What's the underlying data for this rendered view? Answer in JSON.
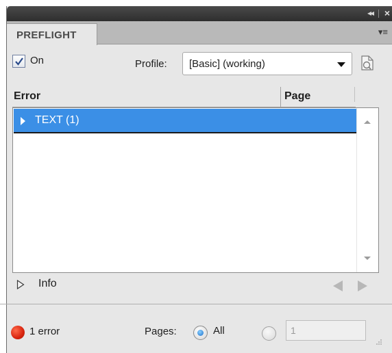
{
  "panel": {
    "tab_title": "PREFLIGHT",
    "panel_menu_glyph": "▾≡",
    "collapse_glyph": "◂◂",
    "close_glyph": "×"
  },
  "controls": {
    "on_checked": true,
    "on_label": "On",
    "profile_label": "Profile:",
    "profile_value": "[Basic] (working)"
  },
  "table": {
    "columns": [
      "Error",
      "Page"
    ],
    "rows": [
      {
        "label": "TEXT (1)",
        "selected": true,
        "expanded": false
      }
    ]
  },
  "info": {
    "label": "Info"
  },
  "footer": {
    "status_text": "1 error",
    "pages_label": "Pages:",
    "all_label": "All",
    "page_range_value": "1",
    "selected_pages_option": "All"
  },
  "colors": {
    "selection": "#3b8fe6",
    "status_error": "#d8240e",
    "panel_bg": "#e7e7e7"
  }
}
